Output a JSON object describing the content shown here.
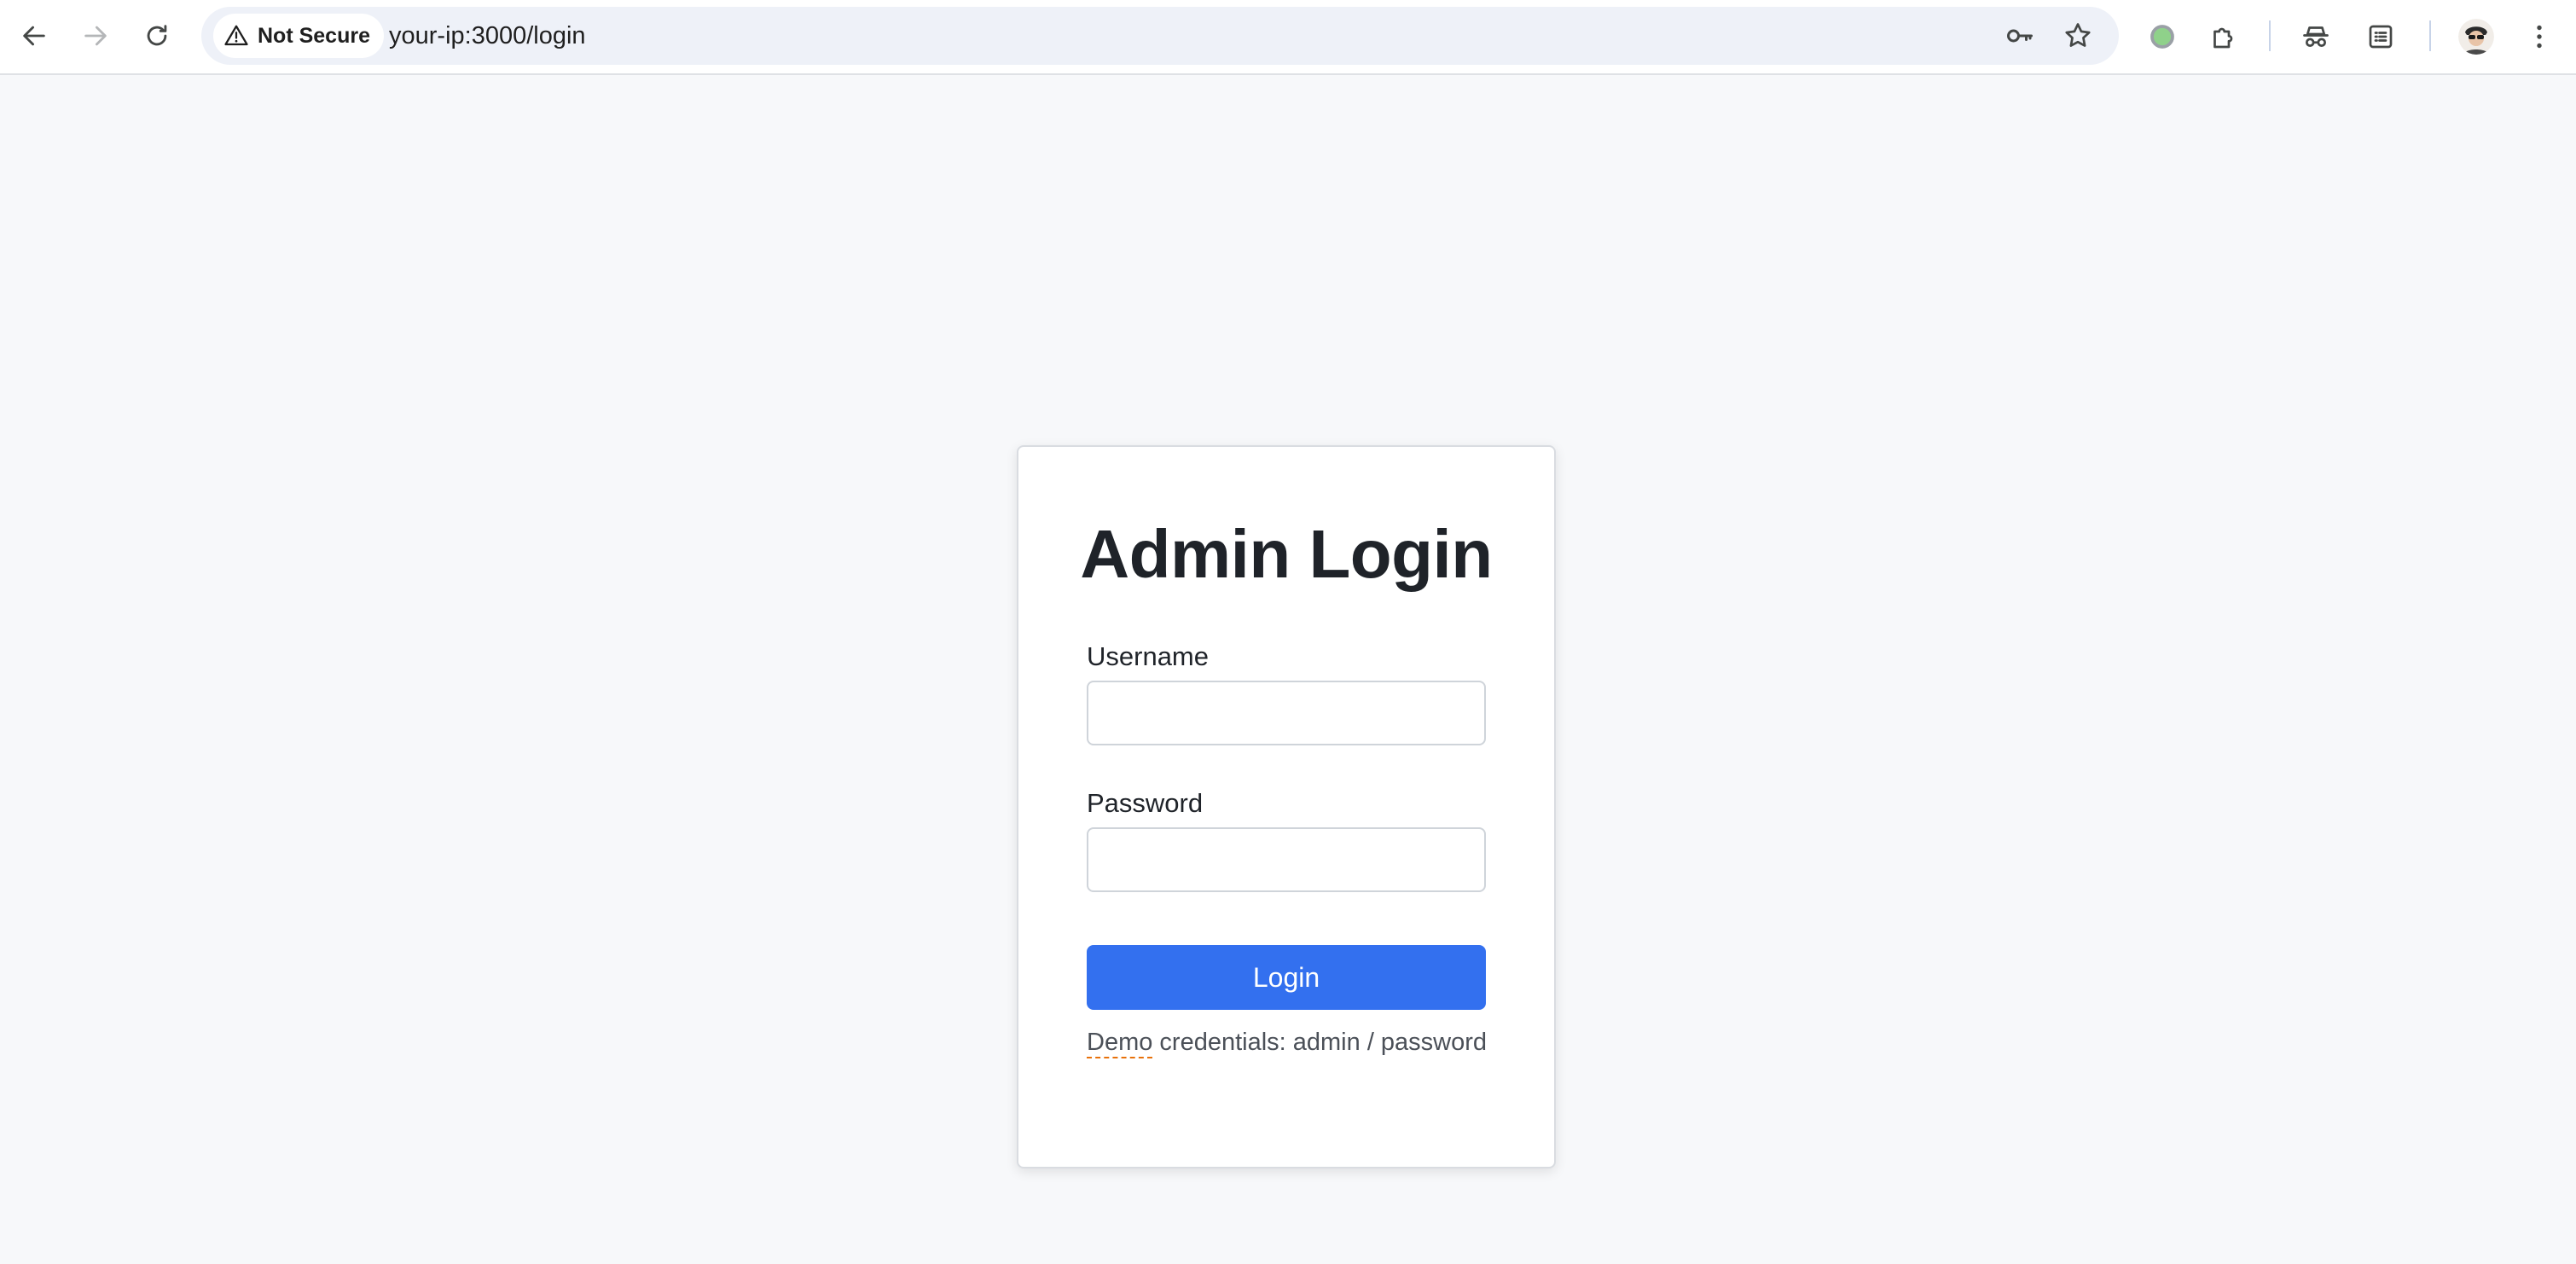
{
  "browser": {
    "security_label": "Not Secure",
    "url": "your-ip:3000/login",
    "icons": {
      "back": "arrow-left-icon",
      "forward": "arrow-right-icon",
      "reload": "reload-icon",
      "warning": "warning-triangle-icon",
      "password": "key-icon",
      "bookmark": "star-icon",
      "extension_status": "green-dot-icon",
      "extensions": "puzzle-icon",
      "incognito": "incognito-icon",
      "reading_list": "reading-list-icon",
      "menu": "kebab-menu-icon"
    }
  },
  "login": {
    "title": "Admin Login",
    "username_label": "Username",
    "username_value": "",
    "password_label": "Password",
    "password_value": "",
    "submit_label": "Login",
    "hint_word": "Demo",
    "hint_rest": " credentials: admin / password"
  },
  "colors": {
    "primary": "#3370ef",
    "page_bg": "#f7f8fa",
    "spellcheck": "#e8710a"
  }
}
